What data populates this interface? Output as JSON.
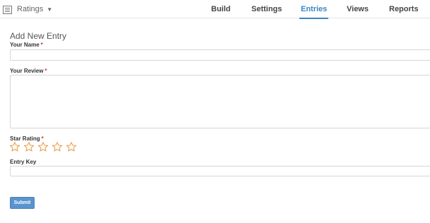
{
  "header": {
    "form_name": "Ratings",
    "tabs": [
      {
        "label": "Build",
        "active": false
      },
      {
        "label": "Settings",
        "active": false
      },
      {
        "label": "Entries",
        "active": true
      },
      {
        "label": "Views",
        "active": false
      },
      {
        "label": "Reports",
        "active": false
      }
    ]
  },
  "form": {
    "heading": "Add New Entry",
    "fields": {
      "name": {
        "label": "Your Name",
        "required_mark": "*",
        "value": "",
        "placeholder": ""
      },
      "review": {
        "label": "Your Review",
        "required_mark": "*",
        "value": "",
        "placeholder": ""
      },
      "rating": {
        "label": "Star Rating",
        "required_mark": "*",
        "max_stars": 5,
        "selected": 0
      },
      "entry_key": {
        "label": "Entry Key",
        "value": "",
        "placeholder": ""
      }
    },
    "submit_label": "Submit"
  },
  "colors": {
    "accent": "#3c85c2",
    "button": "#5a93cd",
    "star_outline": "#e8a04a",
    "required": "#c0392b"
  },
  "icons": {
    "form_switcher": "form-list-icon",
    "dropdown": "caret-down-icon",
    "star": "star-outline-icon"
  }
}
